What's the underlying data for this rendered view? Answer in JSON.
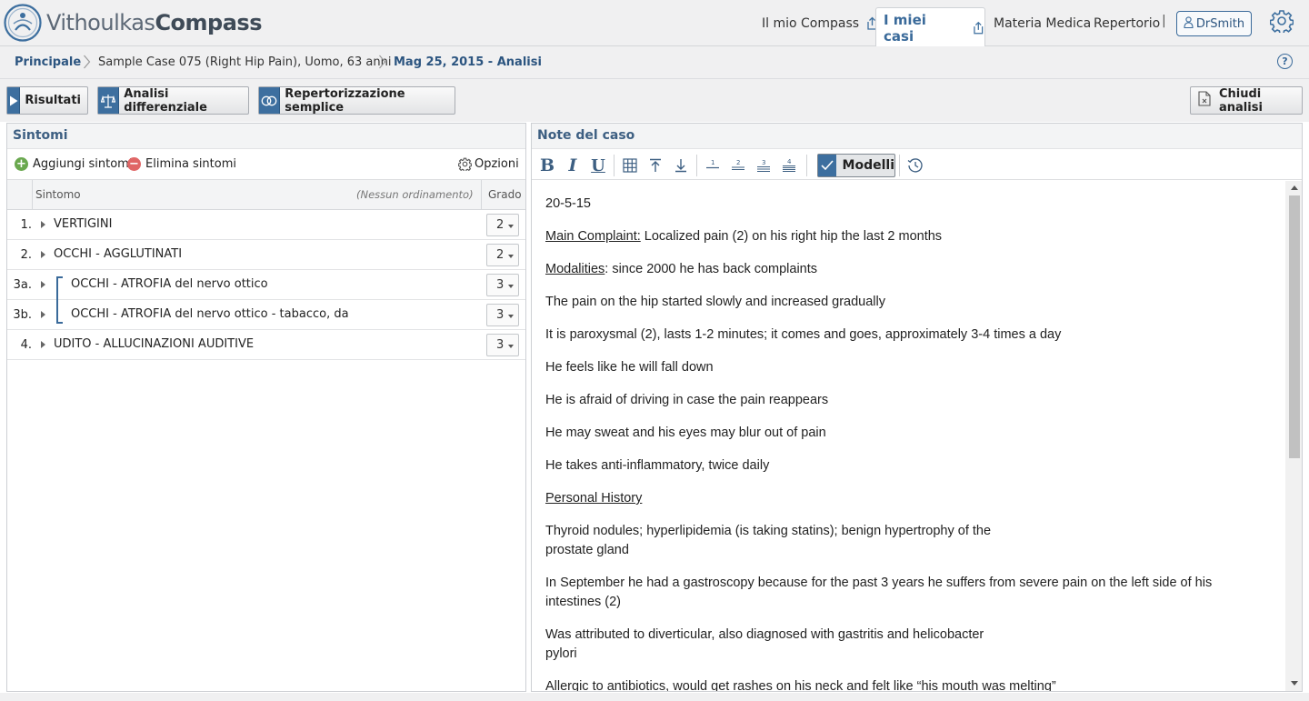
{
  "brand": {
    "part1": "Vithoulkas",
    "part2": "Compass"
  },
  "nav": {
    "mio_compass": "Il mio Compass",
    "miei_casi": "I miei casi",
    "materia_medica": "Materia Medica",
    "repertorio": "Repertorio",
    "separator": "|",
    "user": "DrSmith"
  },
  "breadcrumb": {
    "home": "Principale",
    "case": "Sample Case 075 (Right Hip Pain), Uomo, 63 anni",
    "current": "Mag 25, 2015 - Analisi"
  },
  "actions": {
    "risultati": "Risultati",
    "analisi": "Analisi differenziale",
    "repertorizzazione": "Repertorizzazione semplice",
    "chiudi": "Chiudi analisi"
  },
  "symptoms": {
    "title": "Sintomi",
    "add": "Aggiungi sintomi",
    "delete": "Elimina sintomi",
    "options": "Opzioni",
    "col_symptom": "Sintomo",
    "col_sort": "(Nessun ordinamento)",
    "col_grade": "Grado",
    "rows": [
      {
        "num": "1.",
        "name": "VERTIGINI",
        "grade": "2"
      },
      {
        "num": "2.",
        "name": "OCCHI - AGGLUTINATI",
        "grade": "2"
      },
      {
        "num": "3a.",
        "name": "OCCHI - ATROFIA del nervo ottico",
        "grade": "3"
      },
      {
        "num": "3b.",
        "name": "OCCHI - ATROFIA del nervo ottico - tabacco, da",
        "grade": "3"
      },
      {
        "num": "4.",
        "name": "UDITO - ALLUCINAZIONI AUDITIVE",
        "grade": "3"
      }
    ]
  },
  "notes": {
    "title": "Note del caso",
    "modelli": "Modelli",
    "lines": {
      "date": "20-5-15",
      "mc_label": "Main Complaint:",
      "mc_text": " Localized pain (2) on his right hip the last 2 months",
      "mod_label": "Modalities",
      "mod_text": ": since 2000 he has back complaints",
      "l1": "The pain on the hip started slowly and increased gradually",
      "l2": "It is paroxysmal (2), lasts 1-2 minutes; it comes and goes, approximately 3-4 times a day",
      "l3": "He feels like he will fall down",
      "l4": "He is afraid of driving in case the pain reappears",
      "l5": "He may sweat and his eyes may blur out of pain",
      "l6": "He takes anti-inflammatory, twice daily",
      "ph_label": "Personal History",
      "l7a": "Thyroid nodules; hyperlipidemia (is taking statins); benign hypertrophy of the",
      "l7b": "prostate gland",
      "l8a": "In September he had a gastroscopy because for the past 3 years he suffers from severe pain on the left side of his",
      "l8b": "intestines (2)",
      "l9a": "Was attributed to diverticular, also diagnosed with gastritis and helicobacter",
      "l9b": "pylori",
      "l10": "Allergic to antibiotics, would get rashes on his neck and felt like “his mouth was melting”"
    }
  },
  "icons": [
    "logo-icon",
    "share-icon",
    "user-icon",
    "gear-icon",
    "chevron-right-icon",
    "help-icon",
    "play-icon",
    "scales-icon",
    "circles-icon",
    "close-doc-icon",
    "add-icon",
    "remove-icon",
    "options-gear-icon",
    "expand-arrow-icon",
    "bold-icon",
    "italic-icon",
    "underline-icon",
    "table-icon",
    "move-top-icon",
    "move-bottom-icon",
    "heading-1-icon",
    "heading-2-icon",
    "heading-3-icon",
    "heading-4-icon",
    "checkmark-icon",
    "history-icon"
  ],
  "colors": {
    "accent": "#3d6f9f",
    "link": "#2c5580",
    "add": "#6aa84f",
    "remove": "#e06666"
  }
}
